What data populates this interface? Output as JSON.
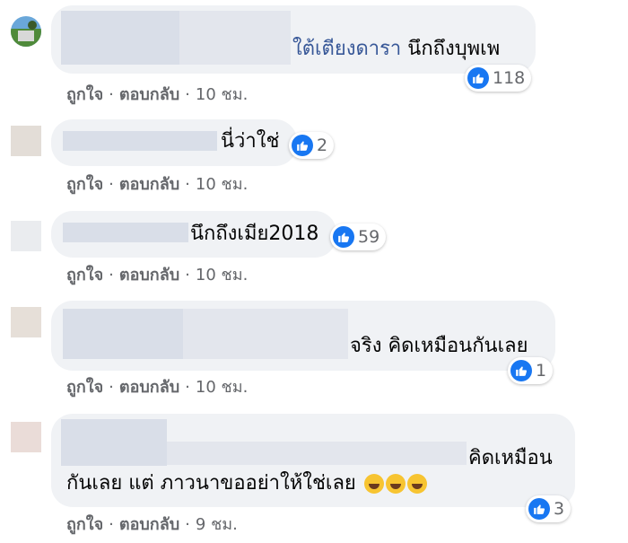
{
  "actions": {
    "like": "ถูกใจ",
    "reply": "ตอบกลับ",
    "separator": "·"
  },
  "comments": [
    {
      "name_text": "ใต้เตียงดารา",
      "text": "นึกถึงบุพเพ",
      "reactions": "118",
      "time": "10 ชม."
    },
    {
      "text": "นี่ว่าใช่",
      "reactions": "2",
      "time": "10 ชม."
    },
    {
      "text": "นึกถึงเมีย2018",
      "reactions": "59",
      "time": "10 ชม."
    },
    {
      "text": "จริง คิดเหมือนกันเลย",
      "reactions": "1",
      "time": "10 ชม."
    },
    {
      "text_line1": "คิดเหมือน",
      "text_line2": "กันเลย แต่ ภาวนาขออย่าให้ใช่เลย",
      "reactions": "3",
      "time": "9 ชม."
    }
  ]
}
